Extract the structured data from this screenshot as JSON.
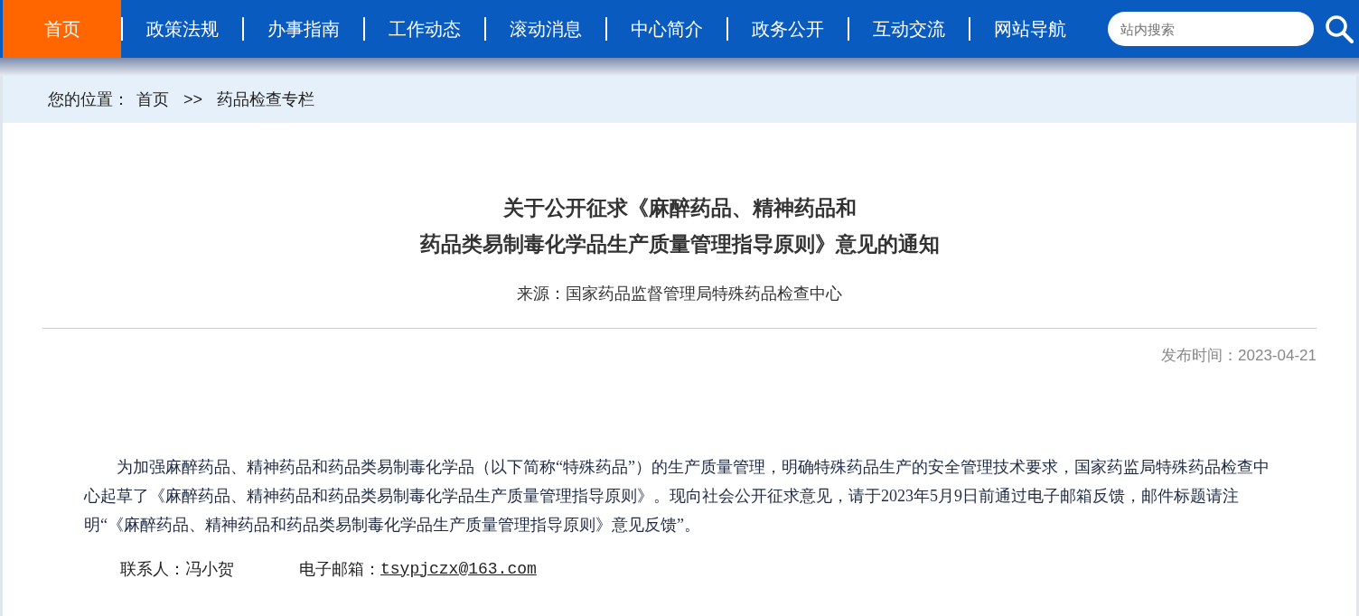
{
  "nav": {
    "items": [
      {
        "label": "首页",
        "selected": true
      },
      {
        "label": "政策法规",
        "selected": false
      },
      {
        "label": "办事指南",
        "selected": false
      },
      {
        "label": "工作动态",
        "selected": false
      },
      {
        "label": "滚动消息",
        "selected": false
      },
      {
        "label": "中心简介",
        "selected": false
      },
      {
        "label": "政务公开",
        "selected": false
      },
      {
        "label": "互动交流",
        "selected": false
      },
      {
        "label": "网站导航",
        "selected": false
      }
    ],
    "search": {
      "placeholder": "站内搜索"
    }
  },
  "breadcrumb": {
    "label": "您的位置：",
    "items": [
      "首页",
      "药品检查专栏"
    ],
    "separator": ">>"
  },
  "article": {
    "title_lines": [
      "关于公开征求《麻醉药品、精神药品和",
      "药品类易制毒化学品生产质量管理指导原则》意见的通知"
    ],
    "source": "来源：国家药品监督管理局特殊药品检查中心",
    "published": "发布时间：2023-04-21",
    "paragraph": "为加强麻醉药品、精神药品和药品类易制毒化学品（以下简称“特殊药品”）的生产质量管理，明确特殊药品生产的安全管理技术要求，国家药监局特殊药品检查中心起草了《麻醉药品、精神药品和药品类易制毒化学品生产质量管理指导原则》。现向社会公开征求意见，请于2023年5月9日前通过电子邮箱反馈，邮件标题请注明“《麻醉药品、精神药品和药品类易制毒化学品生产质量管理指导原则》意见反馈”。",
    "contact": {
      "person": "联系人：冯小贺",
      "email_label": "电子邮箱：",
      "email": "tsypjczx@163.com"
    }
  }
}
